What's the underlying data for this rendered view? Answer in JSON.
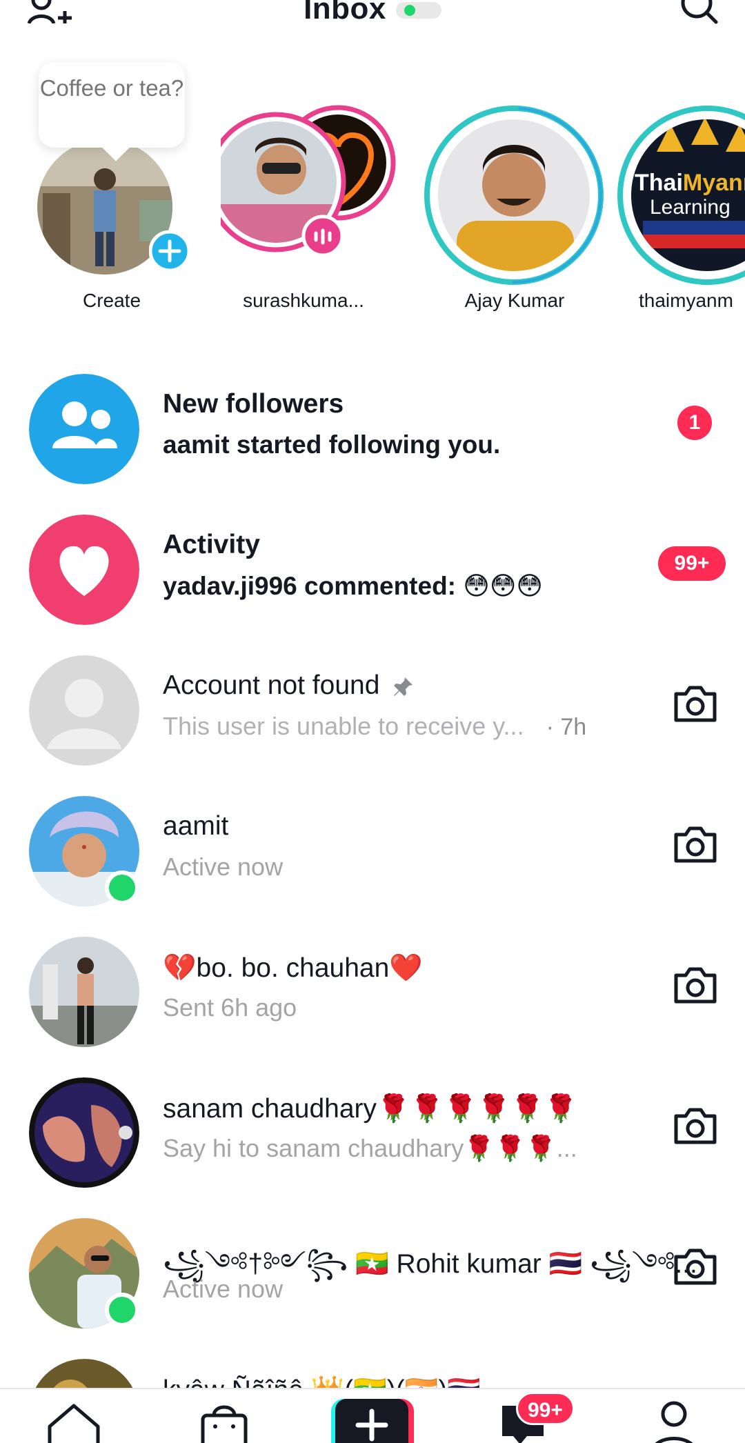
{
  "header": {
    "title": "Inbox",
    "add_friends_icon": "add-user-icon",
    "search_icon": "search-icon"
  },
  "stories": {
    "bubble_text": "Coffee or tea?",
    "items": [
      {
        "name": "Create"
      },
      {
        "name": "surashkuma..."
      },
      {
        "name": "Ajay Kumar"
      },
      {
        "name": "thaimyanm"
      }
    ],
    "story_logo_text": {
      "line1a": "Thai",
      "line1b": "Myann",
      "line2": "Learning"
    }
  },
  "list": {
    "new_followers": {
      "title": "New followers",
      "subtitle": "aamit started following you.",
      "badge": "1"
    },
    "activity": {
      "title": "Activity",
      "subtitle": "yadav.ji996 commented: 😳😳😳",
      "badge": "99+"
    },
    "account_not_found": {
      "title": "Account not found",
      "subtitle": "This user is unable to receive y...",
      "time": "· 7h"
    },
    "aamit": {
      "title": "aamit",
      "subtitle": "Active now"
    },
    "bo_chauhan": {
      "title": "💔bo. bo. chauhan❤️",
      "subtitle": "Sent 6h ago"
    },
    "sanam": {
      "title": "sanam chaudhary🌹🌹🌹🌹🌹🌹",
      "subtitle": "Say hi to sanam chaudhary🌹🌹🌹..."
    },
    "rohit": {
      "title": "꧁༺†༻꧂ 🇲🇲 Rohit  kumar 🇹🇭 ꧁༺...",
      "subtitle": "Active now"
    },
    "kyaw": {
      "title": "kyâw Ñãîñê 👑(🇲🇲)(🇮🇳)🇹🇭"
    }
  },
  "bottom_nav": {
    "home_icon": "home-icon",
    "shop_icon": "shop-icon",
    "create_icon": "plus-icon",
    "inbox_icon": "inbox-icon",
    "inbox_badge": "99+",
    "profile_icon": "profile-icon"
  },
  "colors": {
    "accent": "#fe2c55",
    "online": "#20d56a",
    "followers_blue": "#1fa5e8",
    "story_pink": "#e83e8c",
    "story_teal": "#2ec7c4"
  }
}
